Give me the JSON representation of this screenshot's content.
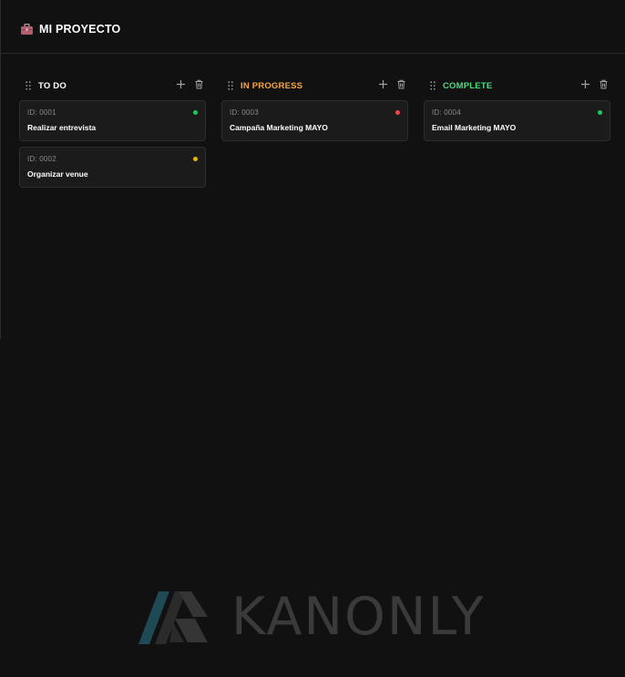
{
  "header": {
    "project_title": "MI PROYECTO",
    "icon": "briefcase-icon"
  },
  "columns": [
    {
      "title": "TO DO",
      "title_color": "#ffffff",
      "cards": [
        {
          "id": "ID: 0001",
          "title": "Realizar entrevista",
          "status_color": "#22c55e"
        },
        {
          "id": "ID: 0002",
          "title": "Organizar venue",
          "status_color": "#eab308"
        }
      ]
    },
    {
      "title": "IN PROGRESS",
      "title_color": "#f5a74a",
      "cards": [
        {
          "id": "ID: 0003",
          "title": "Campaña Marketing MAYO",
          "status_color": "#ef4444"
        }
      ]
    },
    {
      "title": "COMPLETE",
      "title_color": "#4ade80",
      "cards": [
        {
          "id": "ID: 0004",
          "title": "Email Marketing MAYO",
          "status_color": "#22c55e"
        }
      ]
    }
  ],
  "icons": {
    "drag": "drag-handle-icon",
    "add": "plus-icon",
    "delete": "trash-icon"
  },
  "watermark": {
    "brand_name": "KANONLY"
  }
}
